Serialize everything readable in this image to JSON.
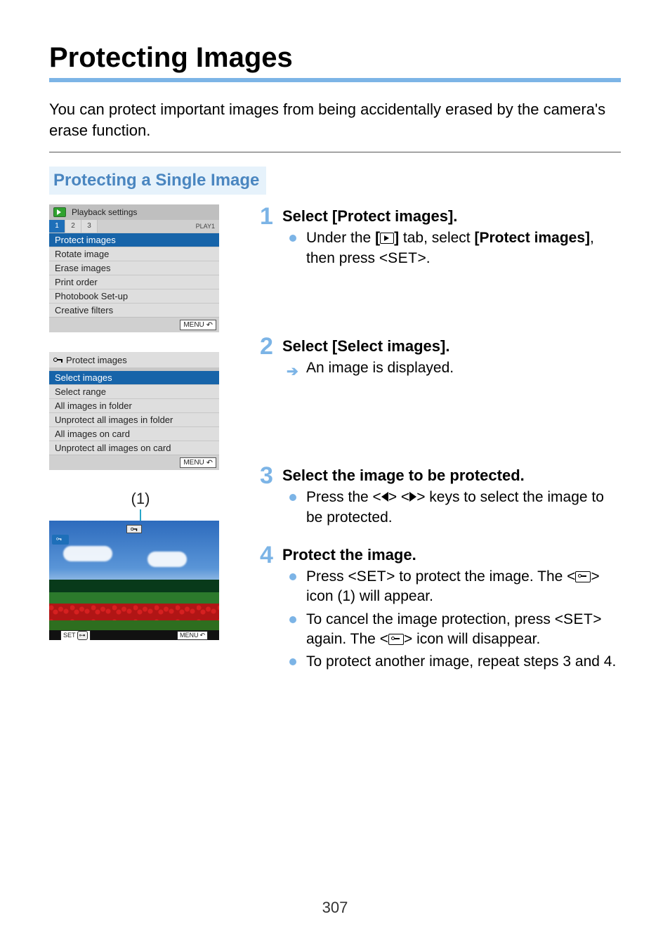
{
  "title": "Protecting Images",
  "intro": "You can protect important images from being accidentally erased by the camera's erase function.",
  "subheading": "Protecting a Single Image",
  "page_number": "307",
  "panel1": {
    "header": "Playback settings",
    "tabs": [
      "1",
      "2",
      "3"
    ],
    "tab_label_right": "PLAY1",
    "items": [
      "Protect images",
      "Rotate image",
      "Erase images",
      "Print order",
      "Photobook Set-up",
      "Creative filters"
    ],
    "footer_btn": "MENU"
  },
  "panel2": {
    "header": "Protect images",
    "items": [
      "Select images",
      "Select range",
      "All images in folder",
      "Unprotect all images in folder",
      "All images on card",
      "Unprotect all images on card"
    ],
    "footer_btn": "MENU"
  },
  "photo": {
    "callout": "(1)",
    "corner": "O",
    "bottom_set": "SET",
    "bottom_on": "O",
    "bottom_menu": "MENU"
  },
  "steps": {
    "s1": {
      "num": "1",
      "title": "Select [Protect images].",
      "b1_a": "Under the ",
      "b1_b": " tab, select ",
      "b1_bold": "[Protect images]",
      "b1_c": ", then press <",
      "b1_set": "SET",
      "b1_d": ">."
    },
    "s2": {
      "num": "2",
      "title": "Select [Select images].",
      "b1": "An image is displayed."
    },
    "s3": {
      "num": "3",
      "title": "Select the image to be protected.",
      "b1_a": "Press the <",
      "b1_b": "> <",
      "b1_c": "> keys to select the image to be protected."
    },
    "s4": {
      "num": "4",
      "title": "Protect the image.",
      "b1_a": "Press <",
      "b1_set": "SET",
      "b1_b": "> to protect the image. The <",
      "b1_c": "> icon (1) will appear.",
      "b2_a": "To cancel the image protection, press <",
      "b2_set": "SET",
      "b2_b": "> again. The <",
      "b2_c": "> icon will disappear.",
      "b3": "To protect another image, repeat steps 3 and 4."
    }
  }
}
